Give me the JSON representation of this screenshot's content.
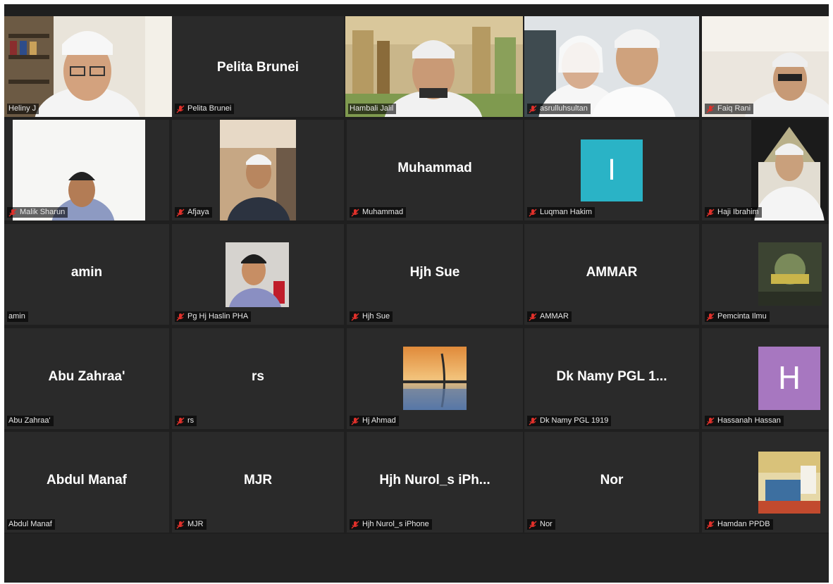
{
  "participants": [
    {
      "display": "",
      "label": "Heliny J",
      "media": "video",
      "active": false
    },
    {
      "display": "Pelita Brunei",
      "label": "Pelita Brunei",
      "media": "name"
    },
    {
      "display": "",
      "label": "Hambali Jalil",
      "media": "video",
      "active": true
    },
    {
      "display": "",
      "label": "asrulluhsultan",
      "media": "video"
    },
    {
      "display": "",
      "label": "Faiq Rani",
      "media": "video"
    },
    {
      "display": "",
      "label": "Malik Sharun",
      "media": "video"
    },
    {
      "display": "",
      "label": "Afjaya",
      "media": "video"
    },
    {
      "display": "Muhammad",
      "label": "Muhammad",
      "media": "name"
    },
    {
      "display": "I",
      "label": "Luqman Hakim",
      "media": "avatar-letter",
      "color": "#2ab3c6"
    },
    {
      "display": "",
      "label": "Haji Ibrahim",
      "media": "video"
    },
    {
      "display": "amin",
      "label": "amin",
      "media": "name"
    },
    {
      "display": "",
      "label": "Pg Hj Haslin PHA",
      "media": "photo"
    },
    {
      "display": "Hjh Sue",
      "label": "Hjh Sue",
      "media": "name"
    },
    {
      "display": "AMMAR",
      "label": "AMMAR",
      "media": "name"
    },
    {
      "display": "",
      "label": "Pemcinta Ilmu",
      "media": "photo"
    },
    {
      "display": "Abu Zahraa'",
      "label": "Abu Zahraa'",
      "media": "name"
    },
    {
      "display": "rs",
      "label": "rs",
      "media": "name"
    },
    {
      "display": "",
      "label": "Hj Ahmad",
      "media": "photo"
    },
    {
      "display": "Dk Namy PGL 1...",
      "label": "Dk Namy PGL 1919",
      "media": "name"
    },
    {
      "display": "H",
      "label": "Hassanah Hassan",
      "media": "avatar-letter",
      "color": "#a777c0"
    },
    {
      "display": "Abdul Manaf",
      "label": "Abdul Manaf",
      "media": "name"
    },
    {
      "display": "MJR",
      "label": "MJR",
      "media": "name"
    },
    {
      "display": "Hjh Nurol_s iPh...",
      "label": "Hjh Nurol_s iPhone",
      "media": "name"
    },
    {
      "display": "Nor",
      "label": "Nor",
      "media": "name"
    },
    {
      "display": "",
      "label": "Hamdan PPDB",
      "media": "photo"
    }
  ],
  "colors": {
    "muted_mic": "#e0302a",
    "active_speaker": "#e6d36a",
    "tile_bg": "#2a2a2a"
  },
  "icons": {
    "mic": "muted-mic-icon"
  }
}
